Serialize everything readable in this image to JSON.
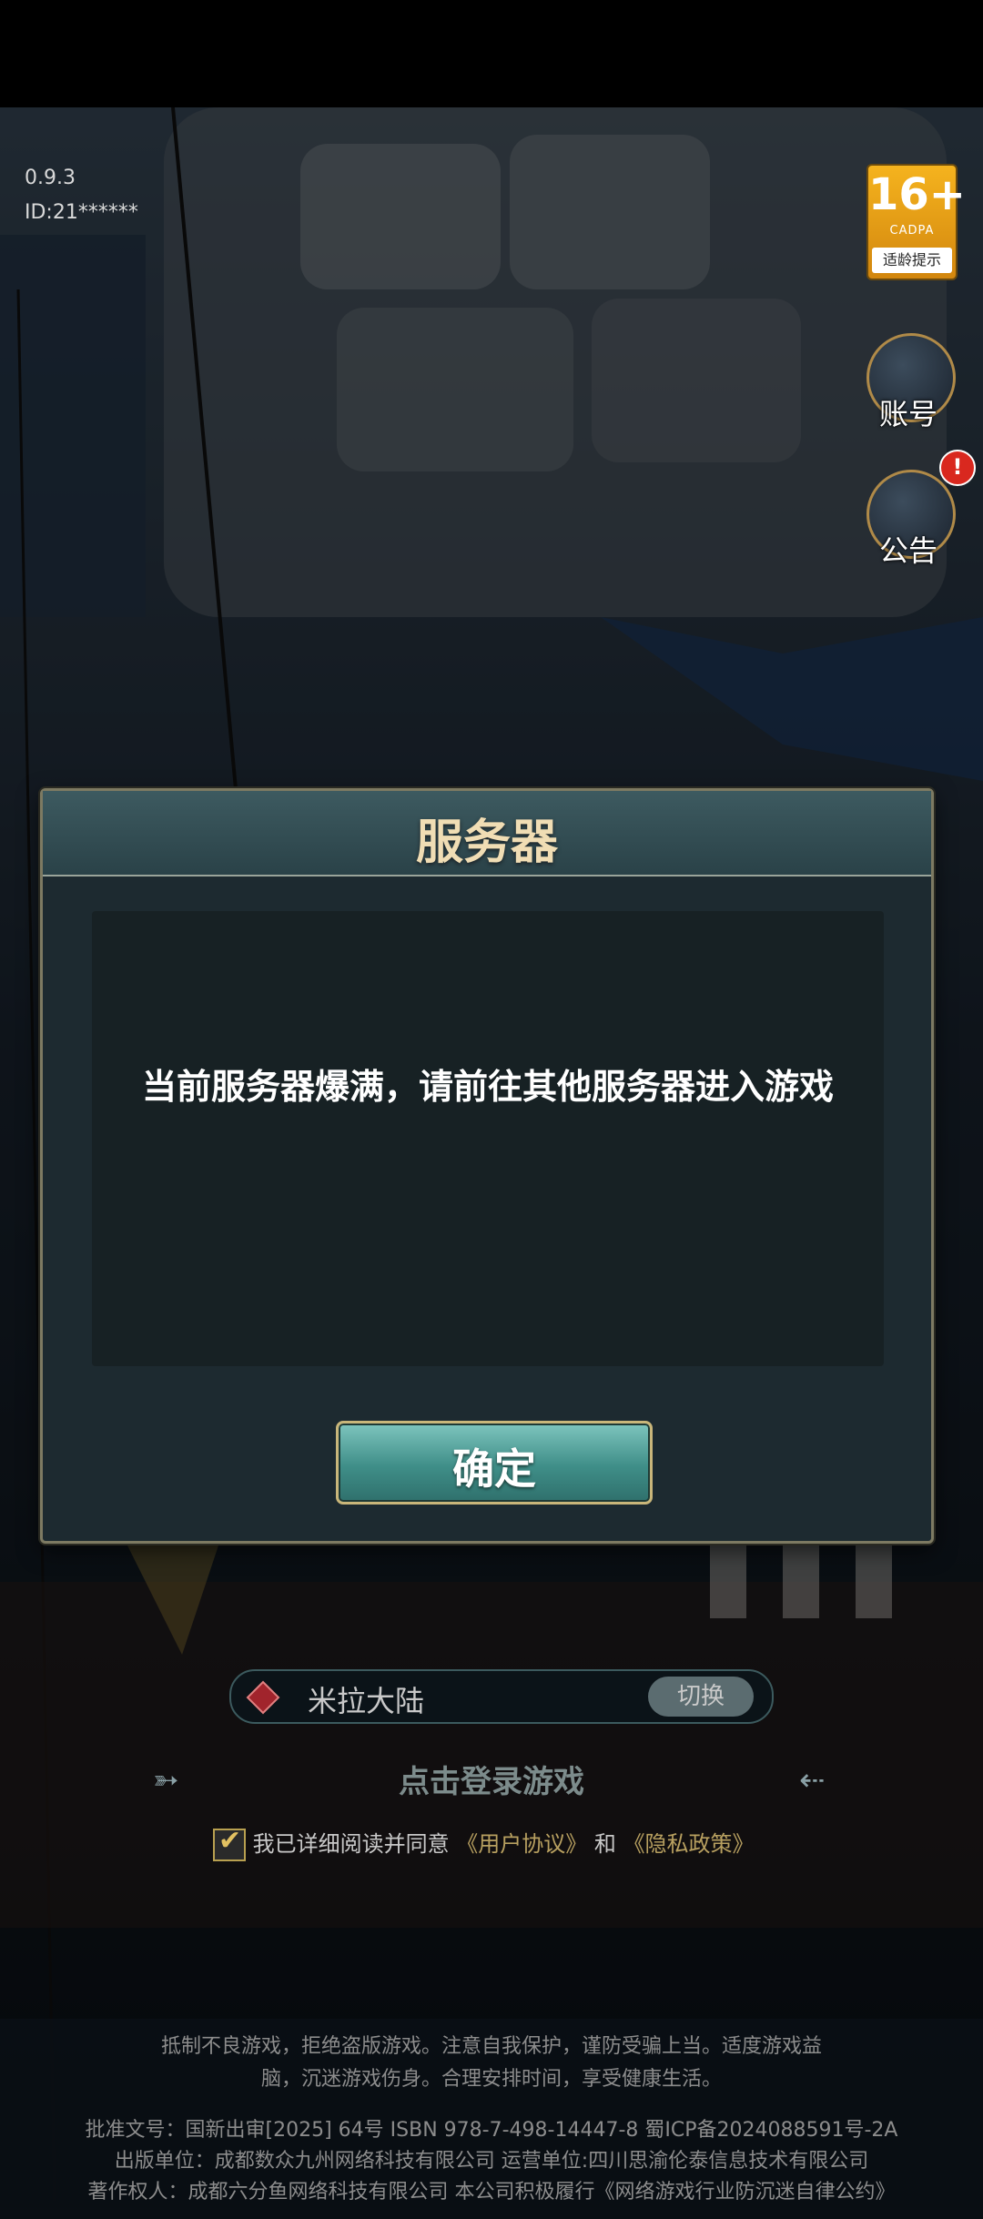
{
  "version": {
    "build": "0.9.3",
    "id": "ID:21******"
  },
  "age_rating": {
    "rating": "16+",
    "org": "CADPA",
    "tip": "适龄提示"
  },
  "side_buttons": {
    "account": "账号",
    "notice": "公告",
    "notice_badge": "!"
  },
  "modal": {
    "title": "服务器",
    "message": "当前服务器爆满，请前往其他服务器进入游戏",
    "confirm": "确定"
  },
  "server": {
    "name": "米拉大陆",
    "switch": "切换"
  },
  "login": {
    "label": "点击登录游戏"
  },
  "agreement": {
    "text": "我已详细阅读并同意",
    "user_agreement": "《用户协议》",
    "and": "和",
    "privacy_policy": "《隐私政策》"
  },
  "footer": {
    "notice_line1": "抵制不良游戏，拒绝盗版游戏。注意自我保护，谨防受骗上当。适度游戏益",
    "notice_line2": "脑，沉迷游戏伤身。合理安排时间，享受健康生活。",
    "approval": "批准文号：国新出审[2025] 64号 ISBN 978-7-498-14447-8 蜀ICP备2024088591号-2A",
    "publisher": "出版单位：成都数众九州网络科技有限公司 运营单位:四川思渝伦泰信息技术有限公司",
    "copyright": "著作权人：成都六分鱼网络科技有限公司 本公司积极履行《网络游戏行业防沉迷自律公约》"
  }
}
